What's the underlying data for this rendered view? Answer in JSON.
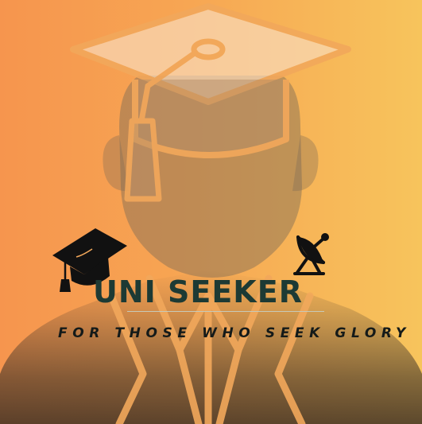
{
  "logo": {
    "name": "UNI SEEKER",
    "tagline": "FOR THOSE WHO SEEK GLORY"
  },
  "colors": {
    "gradient_left": "#f6954e",
    "gradient_right": "#f7c45c",
    "title_text": "#1d3a34",
    "tagline_text": "#141a19"
  },
  "icons": [
    "graduate-silhouette",
    "graduation-cap-icon",
    "satellite-dish-icon"
  ]
}
